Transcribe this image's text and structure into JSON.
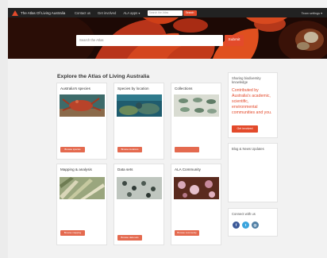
{
  "topnav": {
    "logo_text": "The Atlas Of Living Australia",
    "items": [
      "Contact us",
      "Get involved",
      "ALA apps ▾"
    ],
    "search_placeholder": "Search the Atlas",
    "search_button": "Search",
    "right_text": "Team settings ▾"
  },
  "hero": {
    "search_placeholder": "Search the Atlas",
    "search_button": "Submit"
  },
  "explore": {
    "title": "Explore the Atlas of Living Australia",
    "cards": [
      {
        "title": "Australia's species",
        "button": "Browse species"
      },
      {
        "title": "Species by location",
        "button": "Browse locations"
      },
      {
        "title": "Collections"
      },
      {
        "title": "Mapping & analysis",
        "button": "Browse mapping"
      },
      {
        "title": "Data sets",
        "button": "Browse data sets"
      },
      {
        "title": "ALA Community",
        "button": "Browse community"
      }
    ]
  },
  "sharing": {
    "heading": "Sharing biodiversity knowledge",
    "body": "Contributed by Australia's academic, scientific, environmental communities and you.",
    "button": "Get involved"
  },
  "blog": {
    "heading": "Blog & News Updates"
  },
  "connect": {
    "heading": "Connect with us",
    "icons": [
      "facebook-icon",
      "twitter-icon",
      "instagram-icon"
    ]
  },
  "colors": {
    "accent": "#e34a2b",
    "nav_bg": "#222222",
    "facebook": "#3b5998",
    "twitter": "#3aa4dd",
    "instagram": "#517fa4"
  }
}
